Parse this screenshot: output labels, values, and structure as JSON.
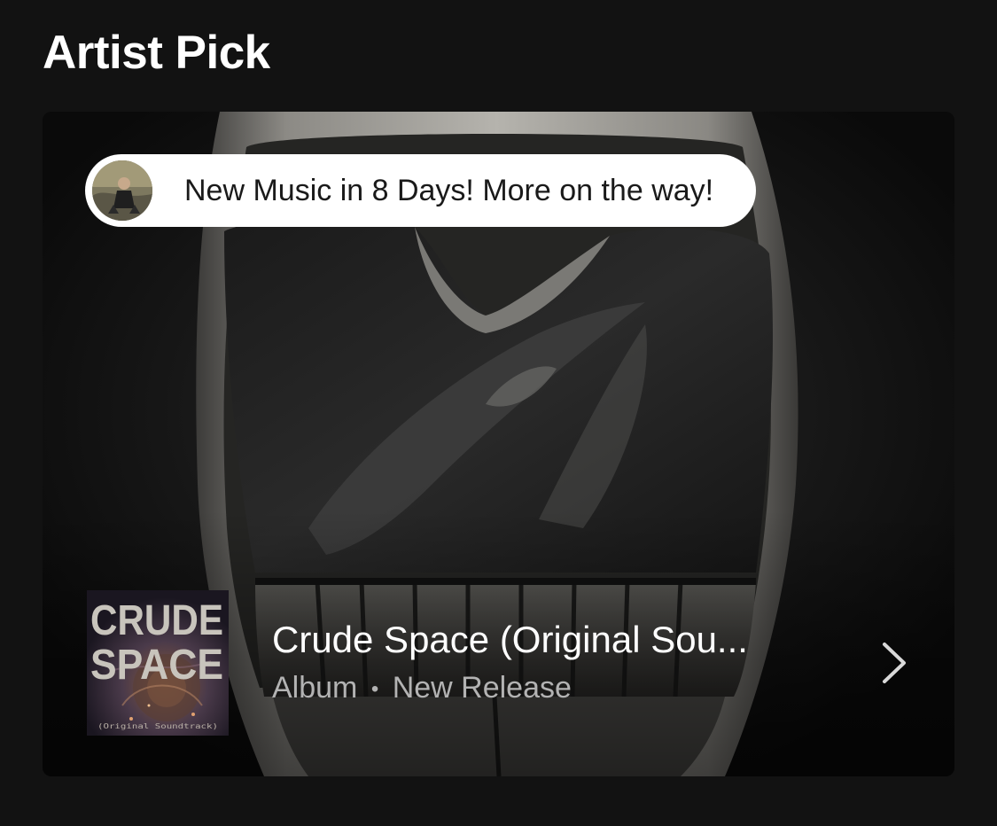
{
  "section": {
    "title": "Artist Pick"
  },
  "artist_pick": {
    "message": "New Music in 8 Days! More on the way!",
    "avatar_icon": "artist-avatar",
    "release": {
      "title": "Crude Space (Original Sou...",
      "type": "Album",
      "separator": "•",
      "tag": "New Release",
      "cover_text": {
        "line1": "CRUDE",
        "line2": "SPACE",
        "subtitle": "(Original Soundtrack)"
      }
    },
    "chevron_icon": "chevron-right-icon"
  },
  "colors": {
    "background": "#121212",
    "card": "#0c0c0c",
    "pill": "#ffffff",
    "title_text": "#ffffff",
    "meta_text": "#b3b3b3"
  }
}
